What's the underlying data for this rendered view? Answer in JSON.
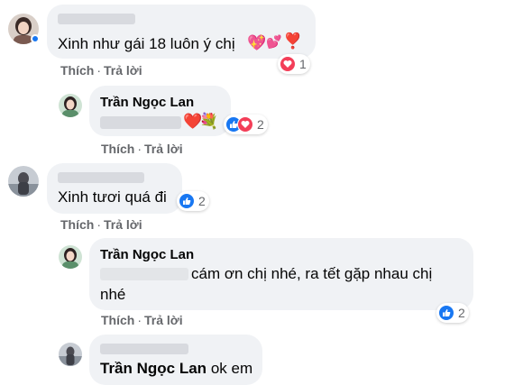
{
  "actions": {
    "like": "Thích",
    "reply": "Trả lời",
    "separator": "·"
  },
  "comments": [
    {
      "text": "Xinh như gái 18 luôn ý chị",
      "emojis": [
        "💖",
        "💕",
        "❣️"
      ],
      "reaction_count": "1",
      "reaction_icons": [
        "heart-icon"
      ]
    },
    {
      "author": "Trần Ngọc Lan",
      "emojis": [
        "❤️",
        "💐"
      ],
      "reaction_count": "2",
      "reaction_icons": [
        "like-icon",
        "heart-icon"
      ]
    },
    {
      "text": "Xinh tươi quá đi",
      "reaction_count": "2",
      "reaction_icons": [
        "like-icon"
      ]
    },
    {
      "author": "Trần Ngọc Lan",
      "text_line1": "cám ơn chị nhé, ra tết gặp nhau chị",
      "text_line2": "nhé",
      "reaction_count": "2",
      "reaction_icons": [
        "like-icon"
      ]
    },
    {
      "mention": "Trần Ngọc Lan",
      "text": "ok em"
    }
  ],
  "colors": {
    "bubble": "#f0f2f5",
    "like_blue": "#1877f2",
    "love_red": "#f33e58",
    "meta_gray": "#65676b"
  }
}
